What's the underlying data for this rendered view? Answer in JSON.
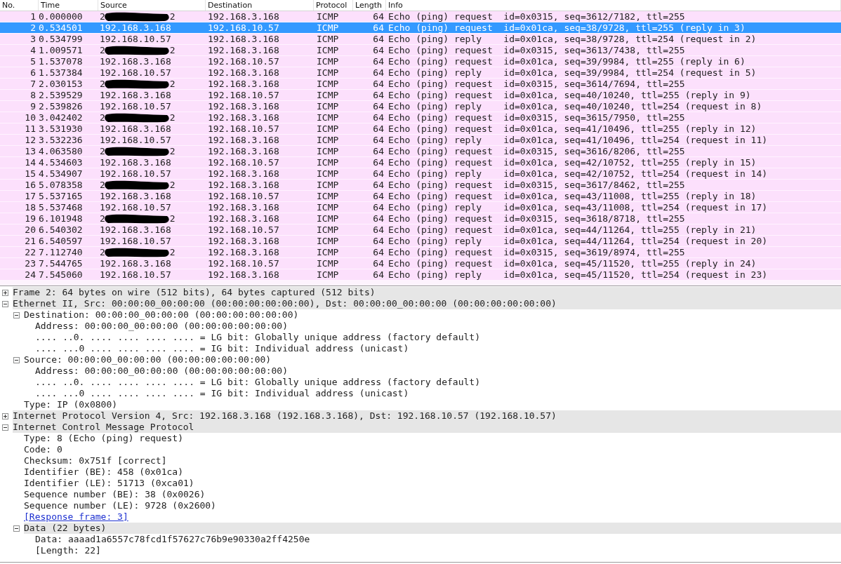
{
  "packet_list": {
    "columns": [
      "No.",
      "Time",
      "Source",
      "Destination",
      "Protocol",
      "Length",
      "Info"
    ],
    "rows": [
      {
        "no": "1",
        "time": "0.000000",
        "source": "2",
        "source_end": "2",
        "redacted": true,
        "destination": "192.168.3.168",
        "protocol": "ICMP",
        "length": "64",
        "info": "Echo (ping) request  id=0x0315, seq=3612/7182, ttl=255",
        "selected": false
      },
      {
        "no": "2",
        "time": "0.534501",
        "source": "192.168.3.168",
        "redacted": false,
        "destination": "192.168.10.57",
        "protocol": "ICMP",
        "length": "64",
        "info": "Echo (ping) request  id=0x01ca, seq=38/9728, ttl=255 (reply in 3)",
        "selected": true
      },
      {
        "no": "3",
        "time": "0.534799",
        "source": "192.168.10.57",
        "redacted": false,
        "destination": "192.168.3.168",
        "protocol": "ICMP",
        "length": "64",
        "info": "Echo (ping) reply    id=0x01ca, seq=38/9728, ttl=254 (request in 2)",
        "selected": false
      },
      {
        "no": "4",
        "time": "1.009571",
        "source": "2",
        "source_end": "2",
        "redacted": true,
        "destination": "192.168.3.168",
        "protocol": "ICMP",
        "length": "64",
        "info": "Echo (ping) request  id=0x0315, seq=3613/7438, ttl=255",
        "selected": false
      },
      {
        "no": "5",
        "time": "1.537078",
        "source": "192.168.3.168",
        "redacted": false,
        "destination": "192.168.10.57",
        "protocol": "ICMP",
        "length": "64",
        "info": "Echo (ping) request  id=0x01ca, seq=39/9984, ttl=255 (reply in 6)",
        "selected": false
      },
      {
        "no": "6",
        "time": "1.537384",
        "source": "192.168.10.57",
        "redacted": false,
        "destination": "192.168.3.168",
        "protocol": "ICMP",
        "length": "64",
        "info": "Echo (ping) reply    id=0x01ca, seq=39/9984, ttl=254 (request in 5)",
        "selected": false
      },
      {
        "no": "7",
        "time": "2.030153",
        "source": "2",
        "source_end": "2",
        "redacted": true,
        "destination": "192.168.3.168",
        "protocol": "ICMP",
        "length": "64",
        "info": "Echo (ping) request  id=0x0315, seq=3614/7694, ttl=255",
        "selected": false
      },
      {
        "no": "8",
        "time": "2.539529",
        "source": "192.168.3.168",
        "redacted": false,
        "destination": "192.168.10.57",
        "protocol": "ICMP",
        "length": "64",
        "info": "Echo (ping) request  id=0x01ca, seq=40/10240, ttl=255 (reply in 9)",
        "selected": false
      },
      {
        "no": "9",
        "time": "2.539826",
        "source": "192.168.10.57",
        "redacted": false,
        "destination": "192.168.3.168",
        "protocol": "ICMP",
        "length": "64",
        "info": "Echo (ping) reply    id=0x01ca, seq=40/10240, ttl=254 (request in 8)",
        "selected": false
      },
      {
        "no": "10",
        "time": "3.042402",
        "source": "2",
        "source_end": "2",
        "redacted": true,
        "destination": "192.168.3.168",
        "protocol": "ICMP",
        "length": "64",
        "info": "Echo (ping) request  id=0x0315, seq=3615/7950, ttl=255",
        "selected": false
      },
      {
        "no": "11",
        "time": "3.531930",
        "source": "192.168.3.168",
        "redacted": false,
        "destination": "192.168.10.57",
        "protocol": "ICMP",
        "length": "64",
        "info": "Echo (ping) request  id=0x01ca, seq=41/10496, ttl=255 (reply in 12)",
        "selected": false
      },
      {
        "no": "12",
        "time": "3.532236",
        "source": "192.168.10.57",
        "redacted": false,
        "destination": "192.168.3.168",
        "protocol": "ICMP",
        "length": "64",
        "info": "Echo (ping) reply    id=0x01ca, seq=41/10496, ttl=254 (request in 11)",
        "selected": false
      },
      {
        "no": "13",
        "time": "4.063580",
        "source": "2",
        "source_end": "2",
        "redacted": true,
        "destination": "192.168.3.168",
        "protocol": "ICMP",
        "length": "64",
        "info": "Echo (ping) request  id=0x0315, seq=3616/8206, ttl=255",
        "selected": false
      },
      {
        "no": "14",
        "time": "4.534603",
        "source": "192.168.3.168",
        "redacted": false,
        "destination": "192.168.10.57",
        "protocol": "ICMP",
        "length": "64",
        "info": "Echo (ping) request  id=0x01ca, seq=42/10752, ttl=255 (reply in 15)",
        "selected": false
      },
      {
        "no": "15",
        "time": "4.534907",
        "source": "192.168.10.57",
        "redacted": false,
        "destination": "192.168.3.168",
        "protocol": "ICMP",
        "length": "64",
        "info": "Echo (ping) reply    id=0x01ca, seq=42/10752, ttl=254 (request in 14)",
        "selected": false
      },
      {
        "no": "16",
        "time": "5.078358",
        "source": "2",
        "source_end": "2",
        "redacted": true,
        "destination": "192.168.3.168",
        "protocol": "ICMP",
        "length": "64",
        "info": "Echo (ping) request  id=0x0315, seq=3617/8462, ttl=255",
        "selected": false
      },
      {
        "no": "17",
        "time": "5.537165",
        "source": "192.168.3.168",
        "redacted": false,
        "destination": "192.168.10.57",
        "protocol": "ICMP",
        "length": "64",
        "info": "Echo (ping) request  id=0x01ca, seq=43/11008, ttl=255 (reply in 18)",
        "selected": false
      },
      {
        "no": "18",
        "time": "5.537468",
        "source": "192.168.10.57",
        "redacted": false,
        "destination": "192.168.3.168",
        "protocol": "ICMP",
        "length": "64",
        "info": "Echo (ping) reply    id=0x01ca, seq=43/11008, ttl=254 (request in 17)",
        "selected": false
      },
      {
        "no": "19",
        "time": "6.101948",
        "source": "2",
        "source_end": "2",
        "redacted": true,
        "destination": "192.168.3.168",
        "protocol": "ICMP",
        "length": "64",
        "info": "Echo (ping) request  id=0x0315, seq=3618/8718, ttl=255",
        "selected": false
      },
      {
        "no": "20",
        "time": "6.540302",
        "source": "192.168.3.168",
        "redacted": false,
        "destination": "192.168.10.57",
        "protocol": "ICMP",
        "length": "64",
        "info": "Echo (ping) request  id=0x01ca, seq=44/11264, ttl=255 (reply in 21)",
        "selected": false
      },
      {
        "no": "21",
        "time": "6.540597",
        "source": "192.168.10.57",
        "redacted": false,
        "destination": "192.168.3.168",
        "protocol": "ICMP",
        "length": "64",
        "info": "Echo (ping) reply    id=0x01ca, seq=44/11264, ttl=254 (request in 20)",
        "selected": false
      },
      {
        "no": "22",
        "time": "7.112740",
        "source": "2",
        "source_end": "2",
        "redacted": true,
        "destination": "192.168.3.168",
        "protocol": "ICMP",
        "length": "64",
        "info": "Echo (ping) request  id=0x0315, seq=3619/8974, ttl=255",
        "selected": false
      },
      {
        "no": "23",
        "time": "7.544765",
        "source": "192.168.3.168",
        "redacted": false,
        "destination": "192.168.10.57",
        "protocol": "ICMP",
        "length": "64",
        "info": "Echo (ping) request  id=0x01ca, seq=45/11520, ttl=255 (reply in 24)",
        "selected": false
      },
      {
        "no": "24",
        "time": "7.545060",
        "source": "192.168.10.57",
        "redacted": false,
        "destination": "192.168.3.168",
        "protocol": "ICMP",
        "length": "64",
        "info": "Echo (ping) reply    id=0x01ca, seq=45/11520, ttl=254 (request in 23)",
        "selected": false
      }
    ]
  },
  "details_tree": [
    {
      "text": "Frame 2: 64 bytes on wire (512 bits), 64 bytes captured (512 bits)",
      "expanded": false,
      "shaded": true
    },
    {
      "text": "Ethernet II, Src: 00:00:00_00:00:00 (00:00:00:00:00:00), Dst: 00:00:00_00:00:00 (00:00:00:00:00:00)",
      "expanded": true,
      "shaded": true,
      "children": [
        {
          "text": "Destination: 00:00:00_00:00:00 (00:00:00:00:00:00)",
          "expanded": true,
          "shaded": false,
          "children": [
            {
              "text": "Address: 00:00:00_00:00:00 (00:00:00:00:00:00)"
            },
            {
              "text": ".... ..0. .... .... .... .... = LG bit: Globally unique address (factory default)"
            },
            {
              "text": ".... ...0 .... .... .... .... = IG bit: Individual address (unicast)"
            }
          ]
        },
        {
          "text": "Source: 00:00:00_00:00:00 (00:00:00:00:00:00)",
          "expanded": true,
          "shaded": false,
          "children": [
            {
              "text": "Address: 00:00:00_00:00:00 (00:00:00:00:00:00)"
            },
            {
              "text": ".... ..0. .... .... .... .... = LG bit: Globally unique address (factory default)"
            },
            {
              "text": ".... ...0 .... .... .... .... = IG bit: Individual address (unicast)"
            }
          ]
        },
        {
          "text": "Type: IP (0x0800)"
        }
      ]
    },
    {
      "text": "Internet Protocol Version 4, Src: 192.168.3.168 (192.168.3.168), Dst: 192.168.10.57 (192.168.10.57)",
      "expanded": false,
      "shaded": true
    },
    {
      "text": "Internet Control Message Protocol",
      "expanded": true,
      "shaded": true,
      "children": [
        {
          "text": "Type: 8 (Echo (ping) request)"
        },
        {
          "text": "Code: 0"
        },
        {
          "text": "Checksum: 0x751f [correct]"
        },
        {
          "text": "Identifier (BE): 458 (0x01ca)"
        },
        {
          "text": "Identifier (LE): 51713 (0xca01)"
        },
        {
          "text": "Sequence number (BE): 38 (0x0026)"
        },
        {
          "text": "Sequence number (LE): 9728 (0x2600)"
        },
        {
          "text": "[Response frame: 3]",
          "link": true
        },
        {
          "text": "Data (22 bytes)",
          "expanded": true,
          "shaded": true,
          "children": [
            {
              "text": "Data: aaaad1a6557c78fcd1f57627c76b9e90330a2ff4250e"
            },
            {
              "text": "[Length: 22]"
            }
          ]
        }
      ]
    }
  ]
}
